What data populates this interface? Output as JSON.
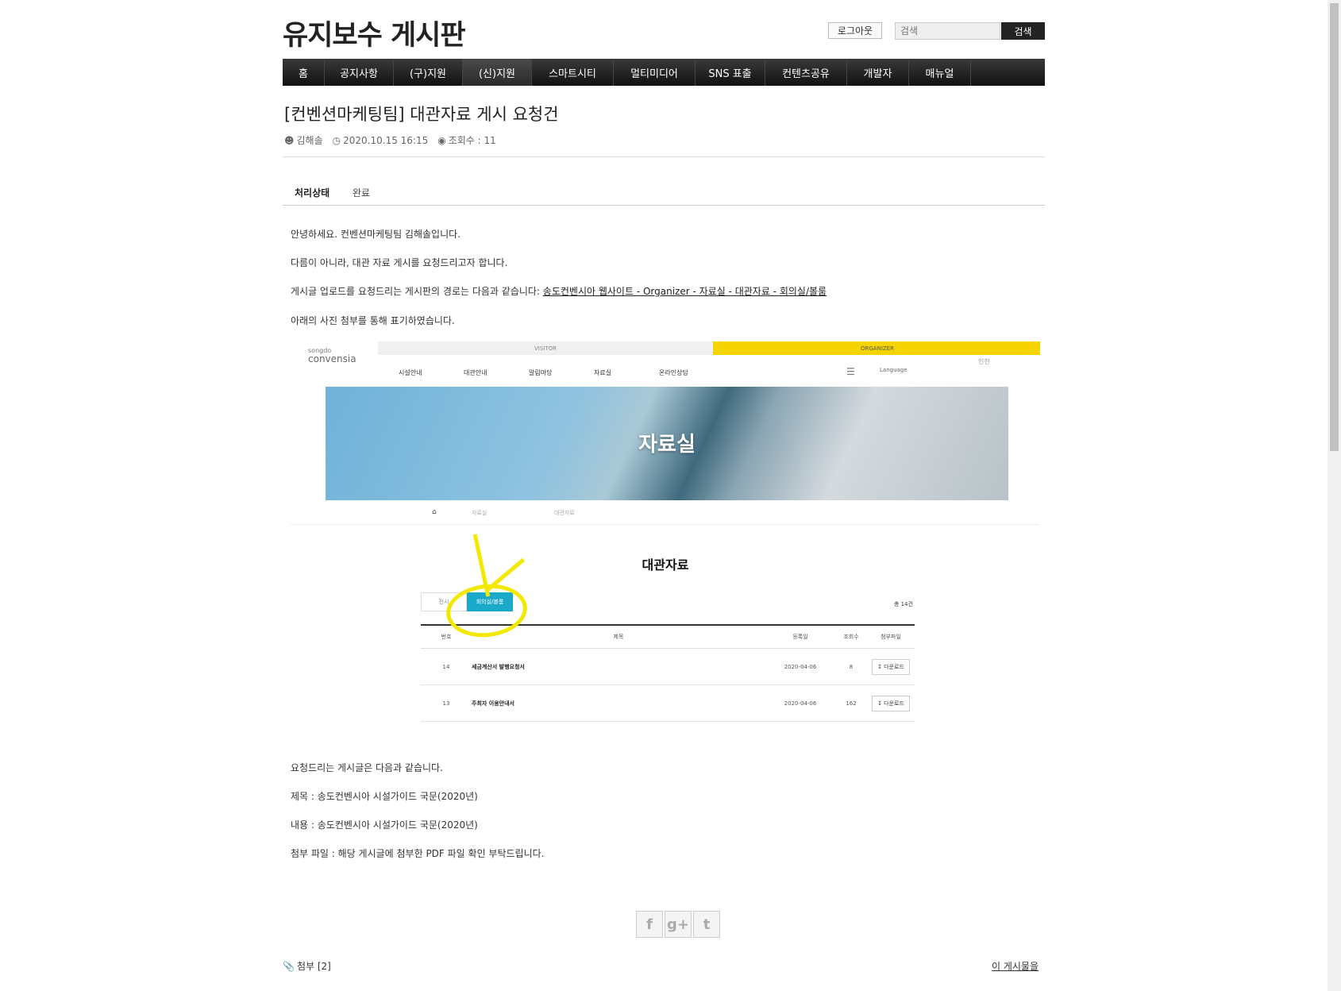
{
  "header": {
    "site_title": "유지보수 게시판",
    "logout_label": "로그아웃",
    "search_placeholder": "검색",
    "search_button": "검색"
  },
  "nav": {
    "items": [
      {
        "label": "홈",
        "width": 53
      },
      {
        "label": "공지사항",
        "width": 87
      },
      {
        "label": "(구)지원",
        "width": 87
      },
      {
        "label": "(신)지원",
        "width": 87
      },
      {
        "label": "스마트시티",
        "width": 103
      },
      {
        "label": "멀티미디어",
        "width": 103
      },
      {
        "label": "SNS 표출",
        "width": 88
      },
      {
        "label": "컨텐츠공유",
        "width": 103
      },
      {
        "label": "개발자",
        "width": 78
      },
      {
        "label": "매뉴얼",
        "width": 78
      }
    ]
  },
  "post": {
    "title": "[컨벤션마케팅팀] 대관자료 게시 요청건",
    "author": "김해솔",
    "datetime": "2020.10.15 16:15",
    "views": "조회수 : 11",
    "status_label": "처리상태",
    "status_value": "완료",
    "p1": "안녕하세요. 컨벤션마케팅팀 김해솔입니다.",
    "p2": "다름이 아니라, 대관 자료 게시를 요청드리고자 합니다.",
    "p3_prefix": "게시글 업로드를 요청드리는 게시판의 경로는 다음과 같습니다: ",
    "p3_link": "송도컨벤시아 웹사이트 - Organizer - 자료실 - 대관자료 - 회의실/볼룸",
    "p4": "아래의 사진 첨부를 통해 표기하였습니다.",
    "p5": "요청드리는 게시글은 다음과 같습니다.",
    "p6": "제목 : 송도컨벤시아 시설가이드 국문(2020년)",
    "p7": "내용 : 송도컨벤시아 시설가이드 국문(2020년)",
    "p8": "첨부 파일 : 해당 게시글에 첨부한 PDF 파일 확인 부탁드립니다."
  },
  "figure": {
    "visitor": "VISITOR",
    "organizer": "ORGANIZER",
    "logo_small": "songdo",
    "logo": "convensia",
    "menu": [
      "시설안내",
      "대관안내",
      "알림마당",
      "자료실",
      "온라인상담"
    ],
    "language": "Language",
    "incheon": "인천",
    "hero_title": "자료실",
    "breadcrumb": [
      "자료실",
      "대관자료"
    ],
    "section_title": "대관자료",
    "tabs": [
      "전시",
      "회의실/볼룸"
    ],
    "total": "총 14건",
    "columns": [
      "번호",
      "제목",
      "등록일",
      "조회수",
      "첨부파일"
    ],
    "rows": [
      {
        "no": "14",
        "title": "세금계산서 발행요청서",
        "date": "2020-04-06",
        "views": "8",
        "file": "다운로드"
      },
      {
        "no": "13",
        "title": "주최자 이용안내서",
        "date": "2020-04-06",
        "views": "162",
        "file": "다운로드"
      }
    ]
  },
  "footer": {
    "attach": "첨부 [2]",
    "this_post": "이 게시물을",
    "social": [
      "f",
      "g+",
      "t"
    ]
  }
}
